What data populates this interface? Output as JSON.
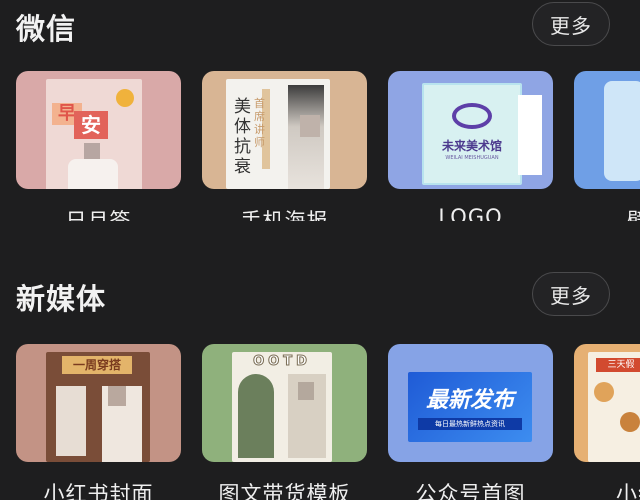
{
  "sections": [
    {
      "title": "微信",
      "more_label": "更多",
      "items": [
        {
          "label": "日月签",
          "thumb_text": [
            "早",
            "安"
          ]
        },
        {
          "label": "手机海报",
          "thumb_text": [
            "首席讲师",
            "美体",
            "抗衰"
          ]
        },
        {
          "label": "LOGO",
          "thumb_text": [
            "未来美术馆",
            "WEILAI MEISHUGUAN"
          ]
        },
        {
          "label": "壁纸"
        }
      ]
    },
    {
      "title": "新媒体",
      "more_label": "更多",
      "items": [
        {
          "label": "小红书封面",
          "thumb_text": [
            "一周穿搭"
          ]
        },
        {
          "label": "图文带货模板",
          "thumb_text": [
            "OOTD"
          ]
        },
        {
          "label": "公众号首图",
          "thumb_text": [
            "最新发布",
            "每日最热新鲜热点资讯"
          ]
        },
        {
          "label": "小红书",
          "thumb_text": [
            "三天假"
          ]
        }
      ]
    }
  ],
  "colors": {
    "background": "#1e1e1f",
    "card_rijian": "#d9a9a8",
    "card_poster": "#d8b594",
    "card_logo": "#8fa5e4",
    "card_wallpaper": "#6f9fe6",
    "card_xhs": "#c39385",
    "card_goods": "#8fb17c",
    "card_gzh": "#86a3e6",
    "card_food": "#e6b073"
  }
}
